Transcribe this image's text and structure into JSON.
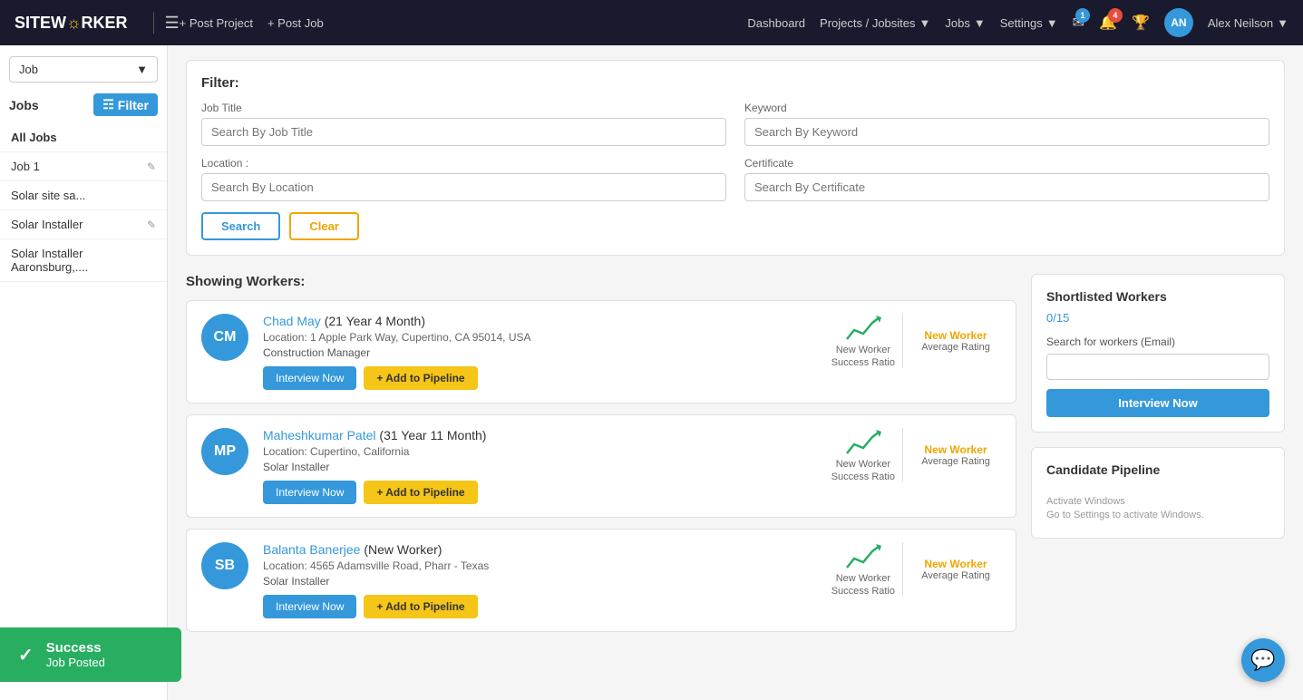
{
  "navbar": {
    "brand": "SITEW",
    "brand_highlight": "O",
    "brand_rest": "RKER",
    "post_project": "+ Post Project",
    "post_job": "+ Post Job",
    "nav_links": [
      {
        "label": "Dashboard",
        "id": "dashboard"
      },
      {
        "label": "Projects / Jobsites",
        "id": "projects",
        "has_dropdown": true
      },
      {
        "label": "Jobs",
        "id": "jobs",
        "has_dropdown": true
      },
      {
        "label": "Settings",
        "id": "settings",
        "has_dropdown": true
      }
    ],
    "notifications_mail_count": "1",
    "notifications_bell_count": "4",
    "user_initials": "AN",
    "user_name": "Alex Neilson"
  },
  "sidebar": {
    "dropdown_label": "Job",
    "section_title": "Jobs",
    "filter_btn_label": "Filter",
    "items": [
      {
        "label": "All Jobs",
        "id": "all-jobs",
        "editable": false
      },
      {
        "label": "Job 1",
        "id": "job-1",
        "editable": true
      },
      {
        "label": "Solar site sa...",
        "id": "solar-site-sa",
        "editable": false
      },
      {
        "label": "Solar Installer",
        "id": "solar-installer-1",
        "editable": true
      },
      {
        "label": "Solar Installer\nAaronsburg,....",
        "id": "solar-installer-aaronsburg",
        "editable": false
      }
    ]
  },
  "filter": {
    "title": "Filter:",
    "job_title_label": "Job Title",
    "job_title_placeholder": "Search By Job Title",
    "keyword_label": "Keyword",
    "keyword_placeholder": "Search By Keyword",
    "location_label": "Location :",
    "location_placeholder": "Search By Location",
    "certificate_label": "Certificate",
    "certificate_placeholder": "Search By Certificate",
    "search_btn": "Search",
    "clear_btn": "Clear"
  },
  "workers_section": {
    "title": "Showing Workers:",
    "workers": [
      {
        "initials": "CM",
        "name": "Chad May",
        "experience": "(21 Year 4 Month)",
        "location": "Location: 1 Apple Park Way, Cupertino, CA 95014, USA",
        "role": "Construction Manager",
        "interview_btn": "Interview Now",
        "pipeline_btn": "+ Add to Pipeline",
        "new_worker_label": "New Worker",
        "success_ratio_label": "Success Ratio",
        "avg_rating_label": "Average Rating",
        "avg_rating_value": "New Worker"
      },
      {
        "initials": "MP",
        "name": "Maheshkumar Patel",
        "experience": "(31 Year 11 Month)",
        "location": "Location: Cupertino, California",
        "role": "Solar Installer",
        "interview_btn": "Interview Now",
        "pipeline_btn": "+ Add to Pipeline",
        "new_worker_label": "New Worker",
        "success_ratio_label": "Success Ratio",
        "avg_rating_label": "Average Rating",
        "avg_rating_value": "New Worker"
      },
      {
        "initials": "SB",
        "name": "Balanta Banerjee",
        "experience": "(New Worker)",
        "location": "Location: 4565 Adamsville Road, Pharr - Texas",
        "role": "Solar Installer",
        "interview_btn": "Interview Now",
        "pipeline_btn": "+ Add to Pipeline",
        "new_worker_label": "New Worker",
        "success_ratio_label": "Success Ratio",
        "avg_rating_label": "Average Rating",
        "avg_rating_value": "New Worker"
      }
    ]
  },
  "right_panel": {
    "shortlist_title": "Shortlisted Workers",
    "shortlist_count": "0/15",
    "email_search_label": "Search for workers (Email)",
    "email_search_placeholder": "",
    "interview_now_btn": "Interview Now",
    "candidate_pipeline_title": "Candidate Pipeline",
    "activate_windows_text": "Activate Windows",
    "activate_windows_sub": "Go to Settings to activate Windows."
  },
  "toast": {
    "title": "Success",
    "subtitle": "Job Posted"
  }
}
